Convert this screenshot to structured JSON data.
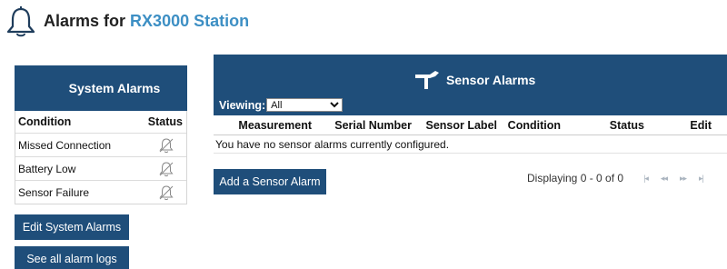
{
  "header": {
    "title_prefix": "Alarms for",
    "station": "RX3000 Station"
  },
  "system_alarms": {
    "title": "System Alarms",
    "columns": {
      "condition": "Condition",
      "status": "Status"
    },
    "rows": [
      {
        "condition": "Missed Connection",
        "status_icon": "alarm-off-icon"
      },
      {
        "condition": "Battery Low",
        "status_icon": "alarm-off-icon"
      },
      {
        "condition": "Sensor Failure",
        "status_icon": "alarm-off-icon"
      }
    ],
    "edit_button": "Edit System Alarms",
    "logs_button": "See all alarm logs"
  },
  "sensor_alarms": {
    "title": "Sensor Alarms",
    "viewing_label": "Viewing:",
    "viewing_value": "All",
    "columns": {
      "measurement": "Measurement",
      "serial": "Serial Number",
      "label": "Sensor Label",
      "condition": "Condition",
      "status": "Status",
      "edit": "Edit"
    },
    "empty_message": "You have no sensor alarms currently configured.",
    "add_button": "Add a Sensor Alarm",
    "pager": {
      "display_text": "Displaying 0 - 0 of 0",
      "first": "|◂",
      "prev": "◂◂",
      "next": "▸▸",
      "last": "▸|"
    }
  },
  "colors": {
    "panel_header": "#1f4e7a",
    "station_link": "#3d8fc4",
    "pager_disabled": "#aab4bf"
  }
}
